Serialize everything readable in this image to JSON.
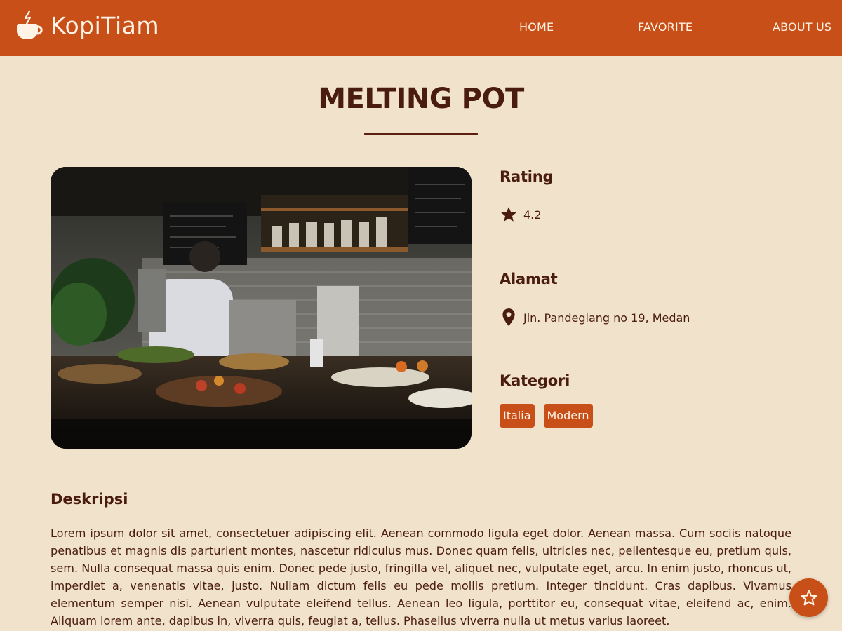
{
  "header": {
    "brand": "KopiTiam",
    "nav": [
      {
        "label": "HOME"
      },
      {
        "label": "FAVORITE"
      },
      {
        "label": "ABOUT US"
      }
    ]
  },
  "restaurant": {
    "name": "MELTING POT",
    "image": {
      "alt": "Melting Pot cafe interior"
    },
    "rating": {
      "heading": "Rating",
      "value": "4.2",
      "icon": "star-icon"
    },
    "address": {
      "heading": "Alamat",
      "value": "Jln. Pandeglang no 19, Medan",
      "icon": "location-pin-icon"
    },
    "categories": {
      "heading": "Kategori",
      "items": [
        "Italia",
        "Modern"
      ]
    },
    "description": {
      "heading": "Deskripsi",
      "text": "Lorem ipsum dolor sit amet, consectetuer adipiscing elit. Aenean commodo ligula eget dolor. Aenean massa. Cum sociis natoque penatibus et magnis dis parturient montes, nascetur ridiculus mus. Donec quam felis, ultricies nec, pellentesque eu, pretium quis, sem. Nulla consequat massa quis enim. Donec pede justo, fringilla vel, aliquet nec, vulputate eget, arcu. In enim justo, rhoncus ut, imperdiet a, venenatis vitae, justo. Nullam dictum felis eu pede mollis pretium. Integer tincidunt. Cras dapibus. Vivamus elementum semper nisi. Aenean vulputate eleifend tellus. Aenean leo ligula, porttitor eu, consequat vitae, eleifend ac, enim. Aliquam lorem ante, dapibus in, viverra quis, feugiat a, tellus. Phasellus viverra nulla ut metus varius laoreet."
    }
  },
  "favorite_button": {
    "icon": "star-outline-icon"
  },
  "colors": {
    "header_bg": "#c84f18",
    "page_bg": "#f1e2cc",
    "text": "#4a1c10",
    "accent": "#c84f18"
  }
}
